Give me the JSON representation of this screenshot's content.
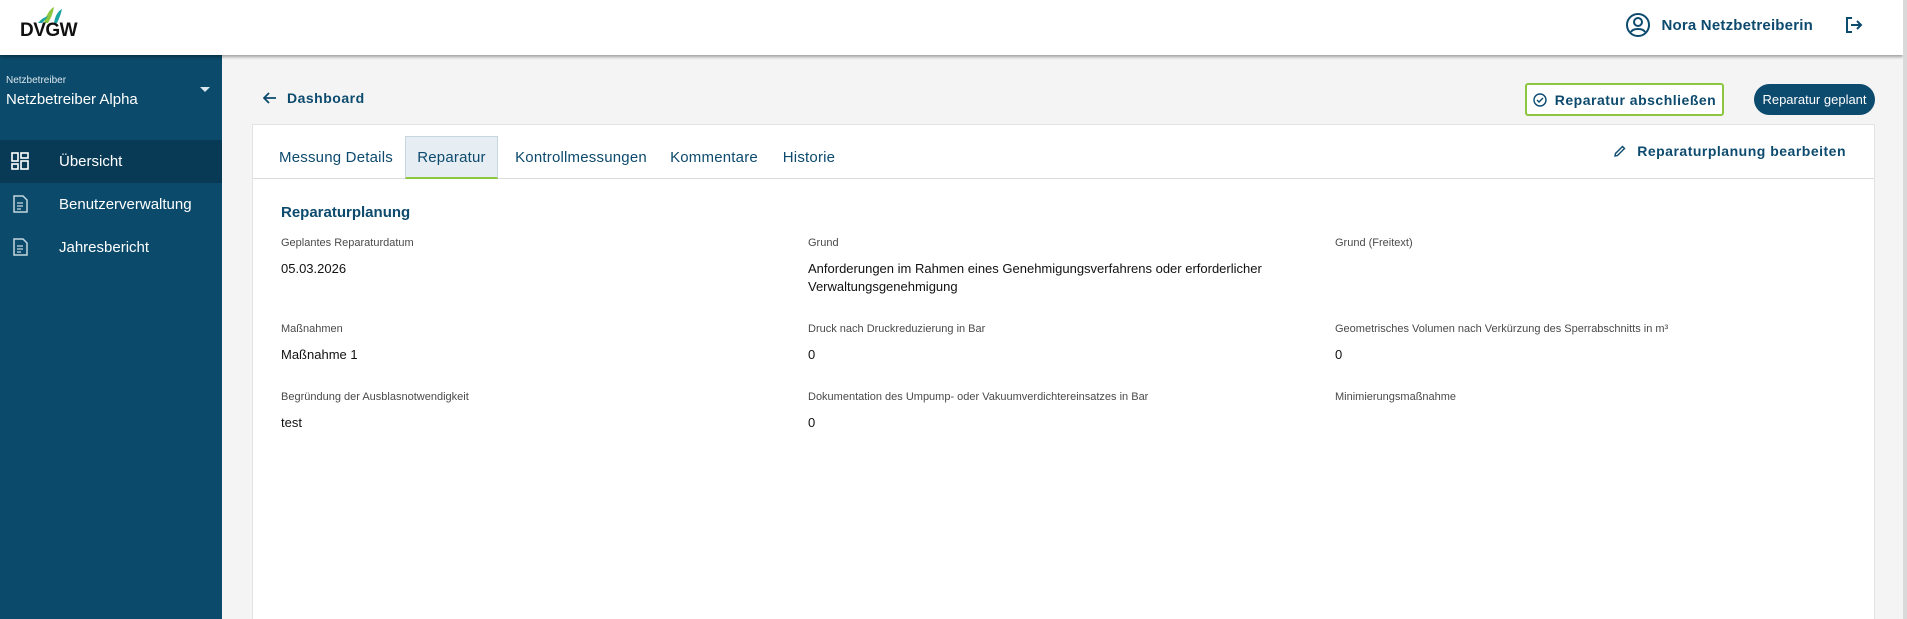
{
  "header": {
    "logo_text": "DVGW",
    "user_name": "Nora Netzbetreiberin"
  },
  "sidebar": {
    "operator_caption": "Netzbetreiber",
    "operator_value": "Netzbetreiber Alpha",
    "items": [
      {
        "label": "Übersicht",
        "icon": "dashboard-icon",
        "active": true
      },
      {
        "label": "Benutzerverwaltung",
        "icon": "document-icon",
        "active": false
      },
      {
        "label": "Jahresbericht",
        "icon": "document-icon",
        "active": false
      }
    ]
  },
  "breadcrumb": {
    "back_label": "Dashboard"
  },
  "actions": {
    "complete_label": "Reparatur abschließen",
    "status_label": "Reparatur geplant"
  },
  "tabs": [
    "Messung Details",
    "Reparatur",
    "Kontrollmessungen",
    "Kommentare",
    "Historie"
  ],
  "active_tab": "Reparatur",
  "edit_label": "Reparaturplanung bearbeiten",
  "section": {
    "title": "Reparaturplanung",
    "fields": [
      {
        "label": "Geplantes Reparaturdatum",
        "value": "05.03.2026"
      },
      {
        "label": "Grund",
        "value": "Anforderungen im Rahmen eines Genehmigungsverfahrens oder erforderlicher Verwaltungsgenehmigung"
      },
      {
        "label": "Grund (Freitext)",
        "value": ""
      },
      {
        "label": "Maßnahmen",
        "value": "Maßnahme 1"
      },
      {
        "label": "Druck nach Druckreduzierung in Bar",
        "value": "0"
      },
      {
        "label": "Geometrisches Volumen nach Verkürzung des Sperrabschnitts in m³",
        "value": "0"
      },
      {
        "label": "Begründung der Ausblasnotwendigkeit",
        "value": "test"
      },
      {
        "label": "Dokumentation des Umpump- oder Vakuumverdichtereinsatzes in Bar",
        "value": "0"
      },
      {
        "label": "Minimierungsmaßnahme",
        "value": ""
      }
    ]
  },
  "colors": {
    "primary": "#0c4a6e",
    "sidebar": "#0b4a6a",
    "accent_green": "#8dc63f",
    "logo_teal": "#1aa3a3",
    "logo_green": "#8dc63f"
  }
}
